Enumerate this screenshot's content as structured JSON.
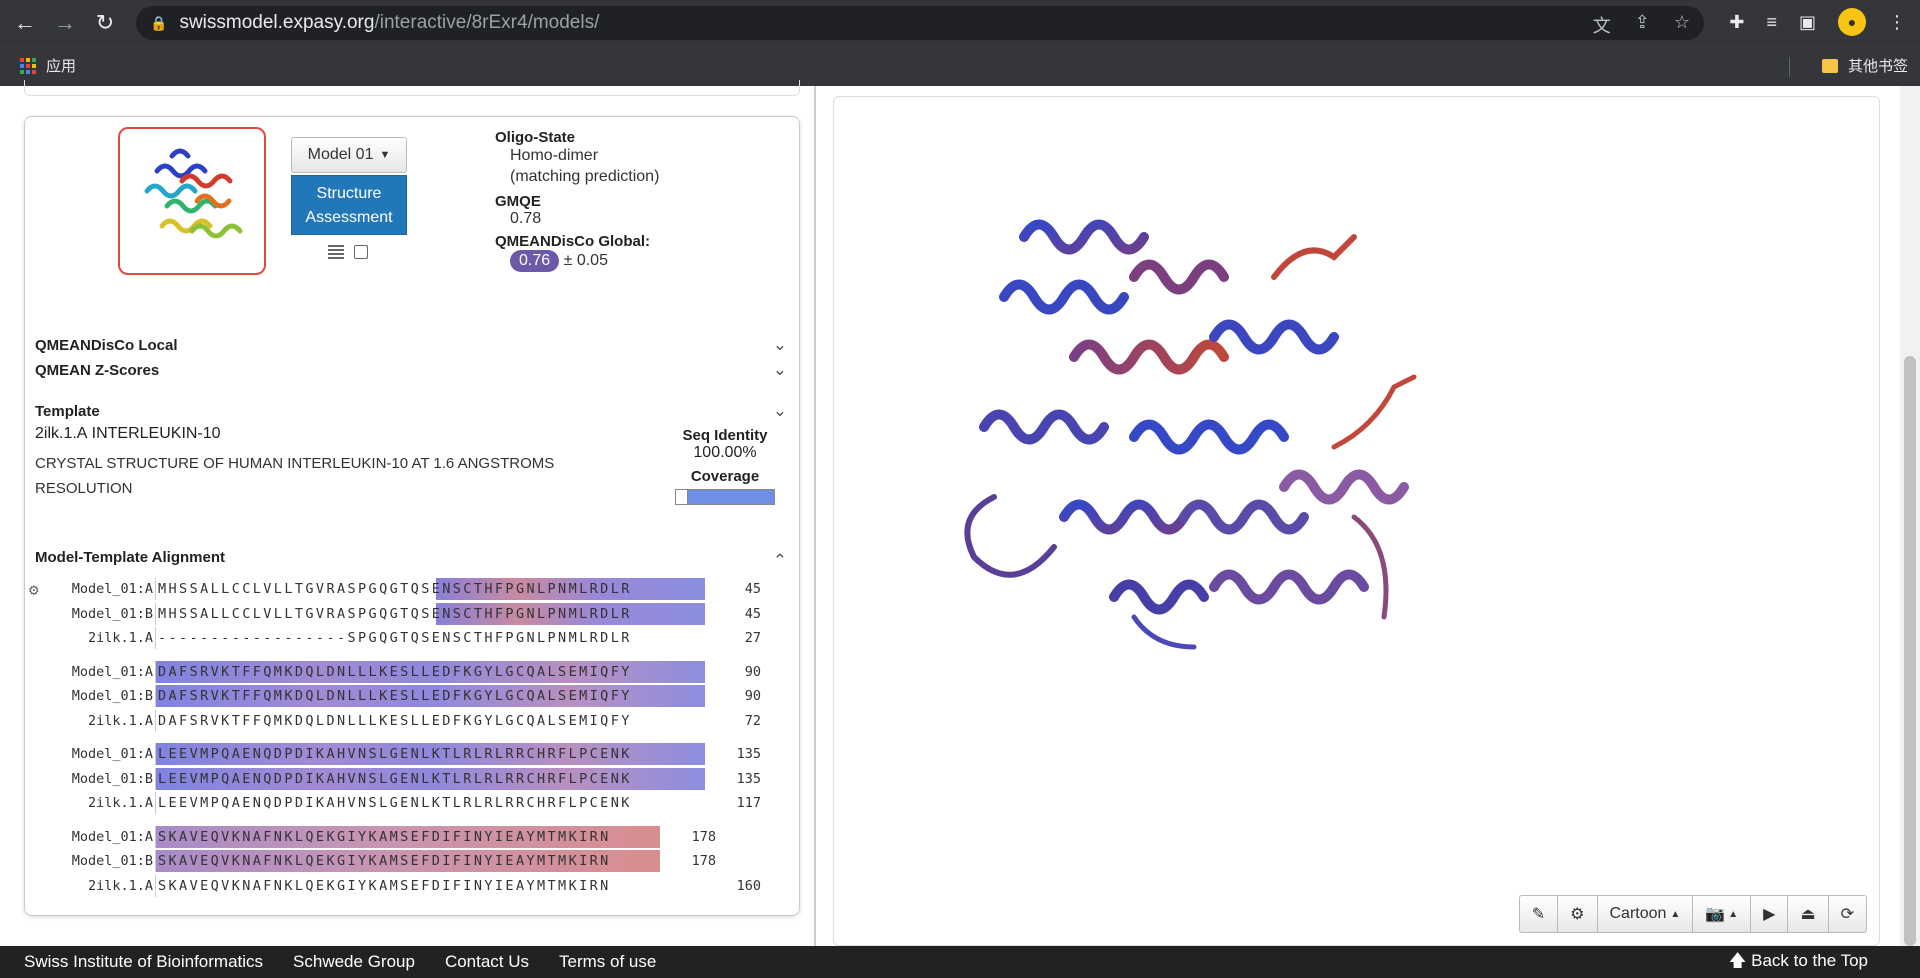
{
  "browser": {
    "url_host": "swissmodel.expasy.org",
    "url_path": "/interactive/8rExr4/models/",
    "bookmark_apps": "应用",
    "bookmark_other": "其他书签"
  },
  "model": {
    "selector_label": "Model 01",
    "assess_label_line1": "Structure",
    "assess_label_line2": "Assessment",
    "oligo_label": "Oligo-State",
    "oligo_value": "Homo-dimer",
    "oligo_note": "(matching prediction)",
    "gmqe_label": "GMQE",
    "gmqe_value": "0.78",
    "qmean_label": "QMEANDisCo Global:",
    "qmean_value": "0.76",
    "qmean_err": "± 0.05"
  },
  "sections": {
    "local": "QMEANDisCo Local",
    "zscores": "QMEAN Z-Scores",
    "template": "Template",
    "alignment": "Model-Template Alignment"
  },
  "template": {
    "id": "2ilk.1.A",
    "name": "INTERLEUKIN-10",
    "desc_line1": "CRYSTAL STRUCTURE OF HUMAN INTERLEUKIN-10 AT 1.6 ANGSTROMS",
    "desc_line2": "RESOLUTION",
    "seq_identity_label": "Seq Identity",
    "seq_identity_value": "100.00%",
    "coverage_label": "Coverage"
  },
  "alignment": [
    {
      "name": "Model_01:A",
      "seq": "MHSSALLCCLVLLTGVRASPGQGTQSENSCTHFPGNLPNMLRDLR",
      "num": "45"
    },
    {
      "name": "Model_01:B",
      "seq": "MHSSALLCCLVLLTGVRASPGQGTQSENSCTHFPGNLPNMLRDLR",
      "num": "45"
    },
    {
      "name": "2ilk.1.A",
      "seq": "------------------SPGQGTQSENSCTHFPGNLPNMLRDLR",
      "num": "27"
    },
    {
      "name": "Model_01:A",
      "seq": "DAFSRVKTFFQMKDQLDNLLLKESLLEDFKGYLGCQALSEMIQFY",
      "num": "90"
    },
    {
      "name": "Model_01:B",
      "seq": "DAFSRVKTFFQMKDQLDNLLLKESLLEDFKGYLGCQALSEMIQFY",
      "num": "90"
    },
    {
      "name": "2ilk.1.A",
      "seq": "DAFSRVKTFFQMKDQLDNLLLKESLLEDFKGYLGCQALSEMIQFY",
      "num": "72"
    },
    {
      "name": "Model_01:A",
      "seq": "LEEVMPQAENQDPDIKAHVNSLGENLKTLRLRLRRCHRFLPCENK",
      "num": "135"
    },
    {
      "name": "Model_01:B",
      "seq": "LEEVMPQAENQDPDIKAHVNSLGENLKTLRLRLRRCHRFLPCENK",
      "num": "135"
    },
    {
      "name": "2ilk.1.A",
      "seq": "LEEVMPQAENQDPDIKAHVNSLGENLKTLRLRLRRCHRFLPCENK",
      "num": "117"
    },
    {
      "name": "Model_01:A",
      "seq": "SKAVEQVKNAFNKLQEKGIYKAMSEFDIFINYIEAYMTMKIRN",
      "num": "178"
    },
    {
      "name": "Model_01:B",
      "seq": "SKAVEQVKNAFNKLQEKGIYKAMSEFDIFINYIEAYMTMKIRN",
      "num": "178"
    },
    {
      "name": "2ilk.1.A",
      "seq": "SKAVEQVKNAFNKLQEKGIYKAMSEFDIFINYIEAYMTMKIRN",
      "num": "160"
    }
  ],
  "viewer": {
    "style_label": "Cartoon"
  },
  "footer": {
    "link1": "Swiss Institute of Bioinformatics",
    "link2": "Schwede Group",
    "link3": "Contact Us",
    "link4": "Terms of use",
    "back": "Back to the Top"
  },
  "colors": {
    "accent_blue": "#2277b8",
    "template_red": "#c0392b",
    "qmean_pill": "#6a5aa8"
  }
}
